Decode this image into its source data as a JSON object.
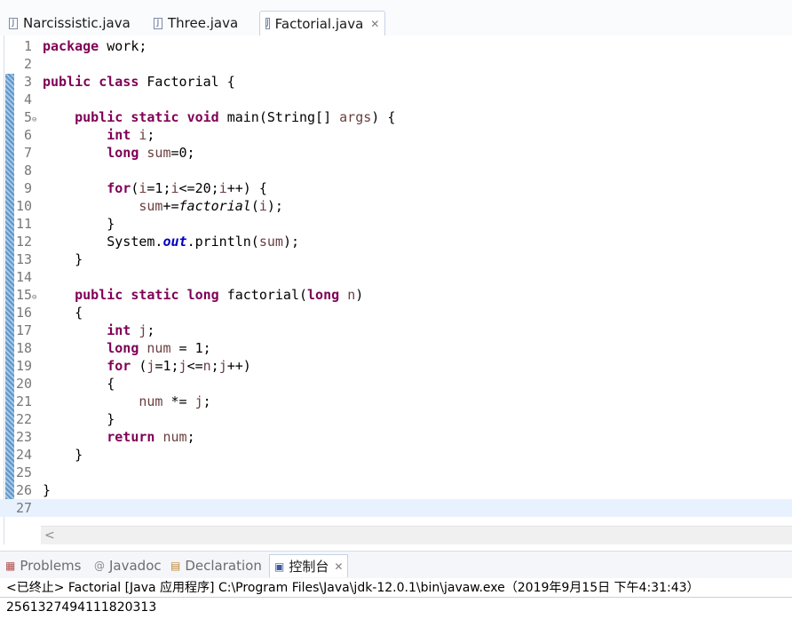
{
  "editor_tabs": [
    {
      "label": "Narcissistic.java",
      "active": false
    },
    {
      "label": "Three.java",
      "active": false
    },
    {
      "label": "Factorial.java",
      "active": true,
      "close_icon": "close-icon"
    }
  ],
  "code_lines": [
    {
      "n": "1",
      "tokens": [
        {
          "t": "package",
          "c": "kw"
        },
        {
          "t": " work;"
        }
      ]
    },
    {
      "n": "2",
      "tokens": []
    },
    {
      "n": "3",
      "tokens": [
        {
          "t": "public",
          "c": "kw"
        },
        {
          "t": " "
        },
        {
          "t": "class",
          "c": "kw"
        },
        {
          "t": " Factorial {"
        }
      ]
    },
    {
      "n": "4",
      "tokens": []
    },
    {
      "n": "5",
      "fold": true,
      "tokens": [
        {
          "t": "    "
        },
        {
          "t": "public",
          "c": "kw"
        },
        {
          "t": " "
        },
        {
          "t": "static",
          "c": "kw"
        },
        {
          "t": " "
        },
        {
          "t": "void",
          "c": "kw"
        },
        {
          "t": " main(String[] "
        },
        {
          "t": "args",
          "c": "var"
        },
        {
          "t": ") {"
        }
      ]
    },
    {
      "n": "6",
      "tokens": [
        {
          "t": "        "
        },
        {
          "t": "int",
          "c": "kw"
        },
        {
          "t": " "
        },
        {
          "t": "i",
          "c": "var"
        },
        {
          "t": ";"
        }
      ]
    },
    {
      "n": "7",
      "tokens": [
        {
          "t": "        "
        },
        {
          "t": "long",
          "c": "kw"
        },
        {
          "t": " "
        },
        {
          "t": "sum",
          "c": "var"
        },
        {
          "t": "=0;"
        }
      ]
    },
    {
      "n": "8",
      "tokens": []
    },
    {
      "n": "9",
      "tokens": [
        {
          "t": "        "
        },
        {
          "t": "for",
          "c": "kw"
        },
        {
          "t": "("
        },
        {
          "t": "i",
          "c": "var"
        },
        {
          "t": "=1;"
        },
        {
          "t": "i",
          "c": "var"
        },
        {
          "t": "<=20;"
        },
        {
          "t": "i",
          "c": "var"
        },
        {
          "t": "++) {"
        }
      ]
    },
    {
      "n": "10",
      "tokens": [
        {
          "t": "            "
        },
        {
          "t": "sum",
          "c": "var"
        },
        {
          "t": "+="
        },
        {
          "t": "factorial",
          "c": "smeth"
        },
        {
          "t": "("
        },
        {
          "t": "i",
          "c": "var"
        },
        {
          "t": ");"
        }
      ]
    },
    {
      "n": "11",
      "tokens": [
        {
          "t": "        }"
        }
      ]
    },
    {
      "n": "12",
      "tokens": [
        {
          "t": "        System."
        },
        {
          "t": "out",
          "c": "field"
        },
        {
          "t": ".println("
        },
        {
          "t": "sum",
          "c": "var"
        },
        {
          "t": ");"
        }
      ]
    },
    {
      "n": "13",
      "tokens": [
        {
          "t": "    }"
        }
      ]
    },
    {
      "n": "14",
      "tokens": []
    },
    {
      "n": "15",
      "fold": true,
      "tokens": [
        {
          "t": "    "
        },
        {
          "t": "public",
          "c": "kw"
        },
        {
          "t": " "
        },
        {
          "t": "static",
          "c": "kw"
        },
        {
          "t": " "
        },
        {
          "t": "long",
          "c": "kw"
        },
        {
          "t": " factorial("
        },
        {
          "t": "long",
          "c": "kw"
        },
        {
          "t": " "
        },
        {
          "t": "n",
          "c": "var"
        },
        {
          "t": ")"
        }
      ]
    },
    {
      "n": "16",
      "tokens": [
        {
          "t": "    {"
        }
      ]
    },
    {
      "n": "17",
      "tokens": [
        {
          "t": "        "
        },
        {
          "t": "int",
          "c": "kw"
        },
        {
          "t": " "
        },
        {
          "t": "j",
          "c": "var"
        },
        {
          "t": ";"
        }
      ]
    },
    {
      "n": "18",
      "tokens": [
        {
          "t": "        "
        },
        {
          "t": "long",
          "c": "kw"
        },
        {
          "t": " "
        },
        {
          "t": "num",
          "c": "var"
        },
        {
          "t": " = 1;"
        }
      ]
    },
    {
      "n": "19",
      "tokens": [
        {
          "t": "        "
        },
        {
          "t": "for",
          "c": "kw"
        },
        {
          "t": " ("
        },
        {
          "t": "j",
          "c": "var"
        },
        {
          "t": "=1;"
        },
        {
          "t": "j",
          "c": "var"
        },
        {
          "t": "<="
        },
        {
          "t": "n",
          "c": "var"
        },
        {
          "t": ";"
        },
        {
          "t": "j",
          "c": "var"
        },
        {
          "t": "++)"
        }
      ]
    },
    {
      "n": "20",
      "tokens": [
        {
          "t": "        {"
        }
      ]
    },
    {
      "n": "21",
      "tokens": [
        {
          "t": "            "
        },
        {
          "t": "num",
          "c": "var"
        },
        {
          "t": " *= "
        },
        {
          "t": "j",
          "c": "var"
        },
        {
          "t": ";"
        }
      ]
    },
    {
      "n": "22",
      "tokens": [
        {
          "t": "        }"
        }
      ]
    },
    {
      "n": "23",
      "tokens": [
        {
          "t": "        "
        },
        {
          "t": "return",
          "c": "kw"
        },
        {
          "t": " "
        },
        {
          "t": "num",
          "c": "var"
        },
        {
          "t": ";"
        }
      ]
    },
    {
      "n": "24",
      "tokens": [
        {
          "t": "    }"
        }
      ]
    },
    {
      "n": "25",
      "tokens": []
    },
    {
      "n": "26",
      "tokens": [
        {
          "t": "}"
        }
      ]
    },
    {
      "n": "27",
      "current": true,
      "tokens": []
    }
  ],
  "scrollbar": {
    "left_arrow": "<"
  },
  "panel_tabs": [
    {
      "label": "Problems",
      "icon": "problems-icon",
      "glyph": "▦",
      "active": false
    },
    {
      "label": "Javadoc",
      "icon": "at-icon",
      "glyph": "@",
      "active": false
    },
    {
      "label": "Declaration",
      "icon": "declaration-icon",
      "glyph": "▤",
      "active": false
    },
    {
      "label": "控制台",
      "icon": "console-icon",
      "glyph": "▣",
      "active": true
    }
  ],
  "console": {
    "header": "<已终止> Factorial [Java 应用程序] C:\\Program Files\\Java\\jdk-12.0.1\\bin\\javaw.exe（2019年9月15日 下午4:31:43）",
    "output": "2561327494111820313"
  },
  "colors": {
    "keyword": "#7f0055",
    "variable": "#6a3e3e",
    "static_field": "#0000c0",
    "current_line": "#e8f2fe"
  }
}
